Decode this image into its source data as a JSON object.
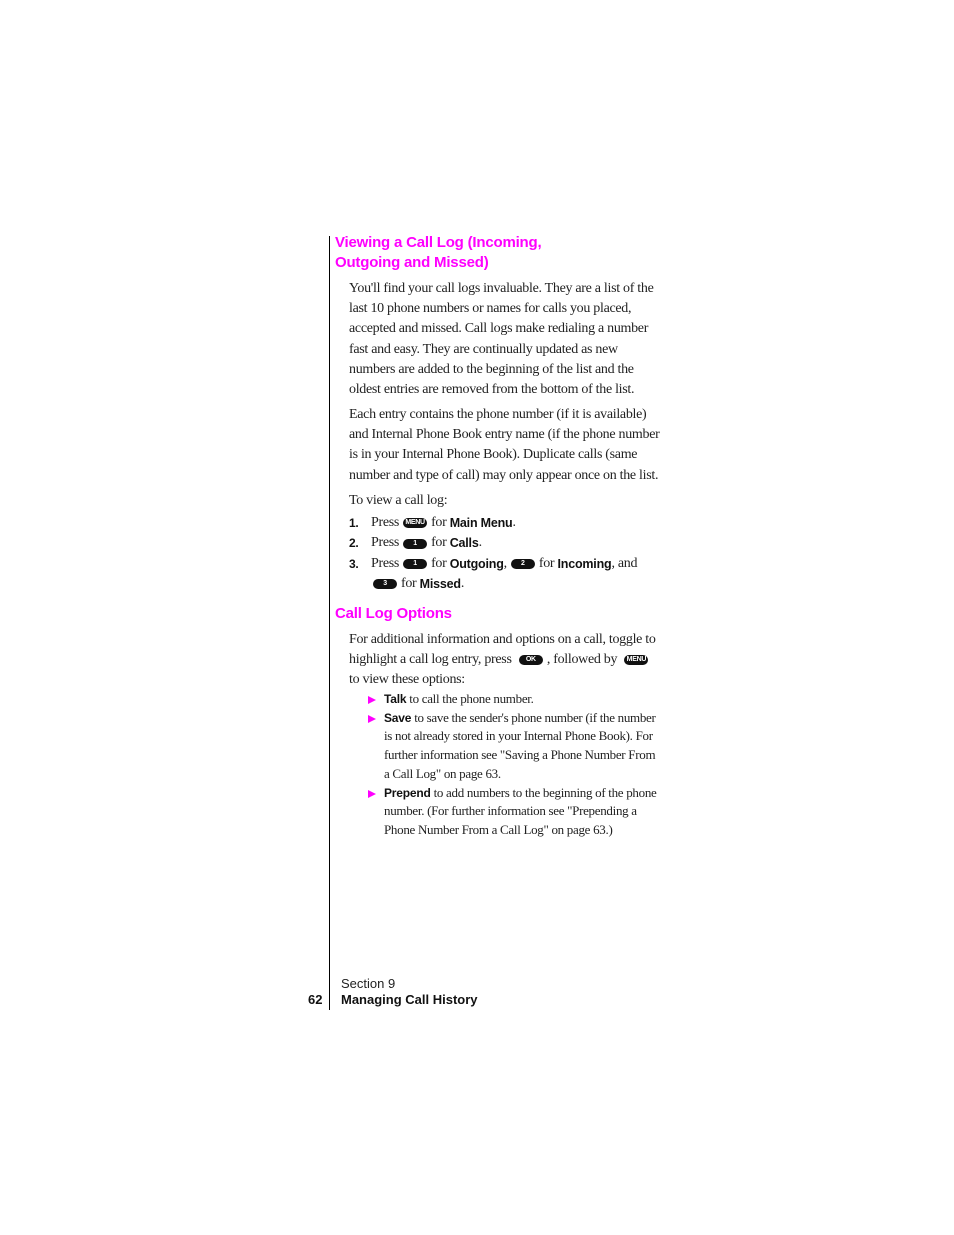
{
  "heading1": [
    "Viewing a Call Log (Incoming,",
    "Outgoing and Missed)"
  ],
  "para1": "You'll find your call logs invaluable. They are a list of the last 10 phone numbers or names for calls you placed, accepted and missed. Call logs make redialing a number fast and easy. They are continually updated as new numbers are added to the beginning of the list and the oldest entries are removed from the bottom of the list.",
  "para2": "Each entry contains the phone number (if it is available) and Internal Phone Book entry name (if the phone number is in your Internal Phone Book). Duplicate calls (same number and type of call) may only appear once on the list.",
  "para3": "To view a call log:",
  "steps": [
    {
      "num": "1.",
      "press": "Press",
      "key": "MENU",
      "for": "for",
      "target": "Main Menu",
      "end": "."
    },
    {
      "num": "2.",
      "press": "Press",
      "key": "1",
      "for": "for",
      "target": "Calls",
      "end": "."
    },
    {
      "num": "3.",
      "press": "Press",
      "key": "1",
      "for": "for",
      "target": "Outgoing",
      "sep": ",",
      "key2": "2",
      "for2": "for",
      "target2": "Incoming",
      "and": ", and",
      "key3": "3",
      "for3": "for",
      "target3": "Missed",
      "end": "."
    }
  ],
  "heading2": "Call Log Options",
  "para4": {
    "a": "For additional information and options on a call, toggle to highlight a call log entry, press",
    "key_ok": "OK",
    "b": ", followed by",
    "key_menu": "MENU",
    "c": "to view these options:"
  },
  "options": [
    {
      "label": "Talk",
      "text": "to call the phone number."
    },
    {
      "label": "Save",
      "text": "to save the sender's phone number (if the number is not already stored in your Internal Phone Book). For further information see \"Saving a Phone Number From a Call Log\" on page 63."
    },
    {
      "label": "Prepend",
      "text": "to add numbers to the beginning of the phone number. (For further information see \"Prepending a Phone Number From a Call Log\" on page 63.)"
    }
  ],
  "footer": {
    "section": "Section 9",
    "page": "62",
    "title": "Managing Call History"
  },
  "colors": {
    "heading": "#ff00ff",
    "bullet": "#ff00ff",
    "text": "#222222"
  }
}
